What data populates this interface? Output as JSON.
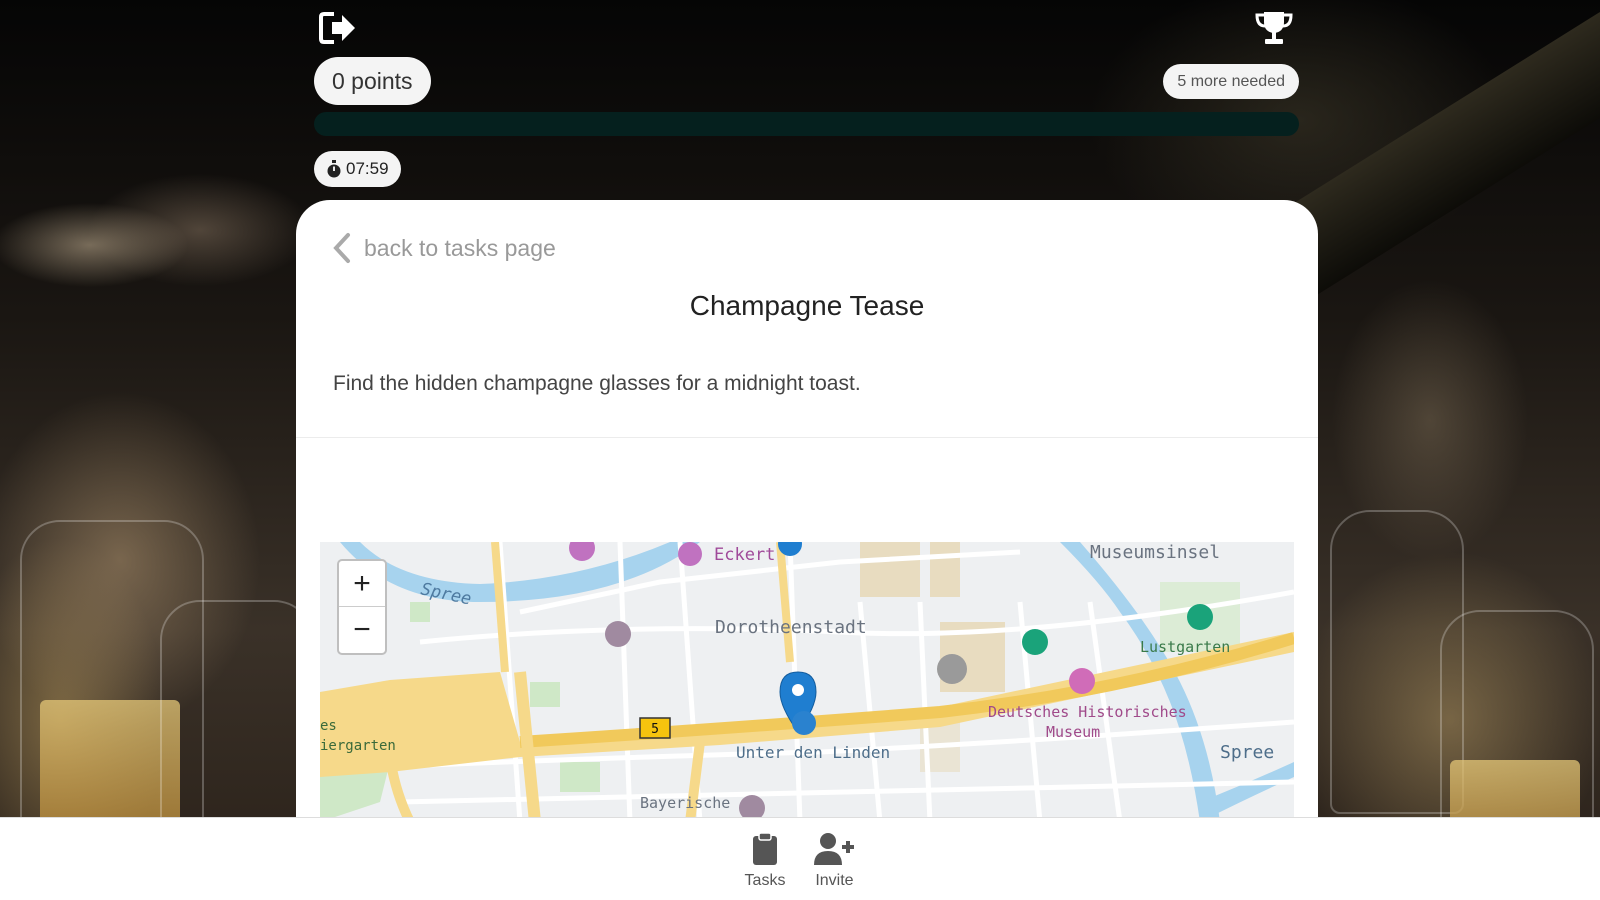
{
  "header": {
    "logout_icon": "logout-icon",
    "trophy_icon": "trophy-icon",
    "points_label": "0 points",
    "needed_label": "5 more needed",
    "progress_fraction": 0,
    "timer": "07:59",
    "timer_icon": "stopwatch-icon"
  },
  "task": {
    "back_label": "back to tasks page",
    "title": "Champagne Tease",
    "description": "Find the hidden champagne glasses for a midnight toast."
  },
  "map": {
    "zoom_in": "+",
    "zoom_out": "−",
    "labels": {
      "eckert": "Eckert",
      "museumsinsel": "Museumsinsel",
      "spree_left": "Spree",
      "dorotheenstadt": "Dorotheenstadt",
      "lustgarten": "Lustgarten",
      "dhm_1": "Deutsches Historisches",
      "dhm_2": "Museum",
      "unter_den_linden": "Unter den Linden",
      "spree_right": "Spree",
      "tiergarten_1": "es",
      "tiergarten_2": "iergarten",
      "bayerische": "Bayerische",
      "route_number": "5"
    },
    "colors": {
      "road_major": "#f6d98a",
      "water": "#a7d3ee",
      "park": "#cfe8c7",
      "marker": "#1f7ed0"
    }
  },
  "nav": {
    "tasks_label": "Tasks",
    "invite_label": "Invite",
    "tasks_icon": "clipboard-icon",
    "invite_icon": "add-user-icon"
  }
}
